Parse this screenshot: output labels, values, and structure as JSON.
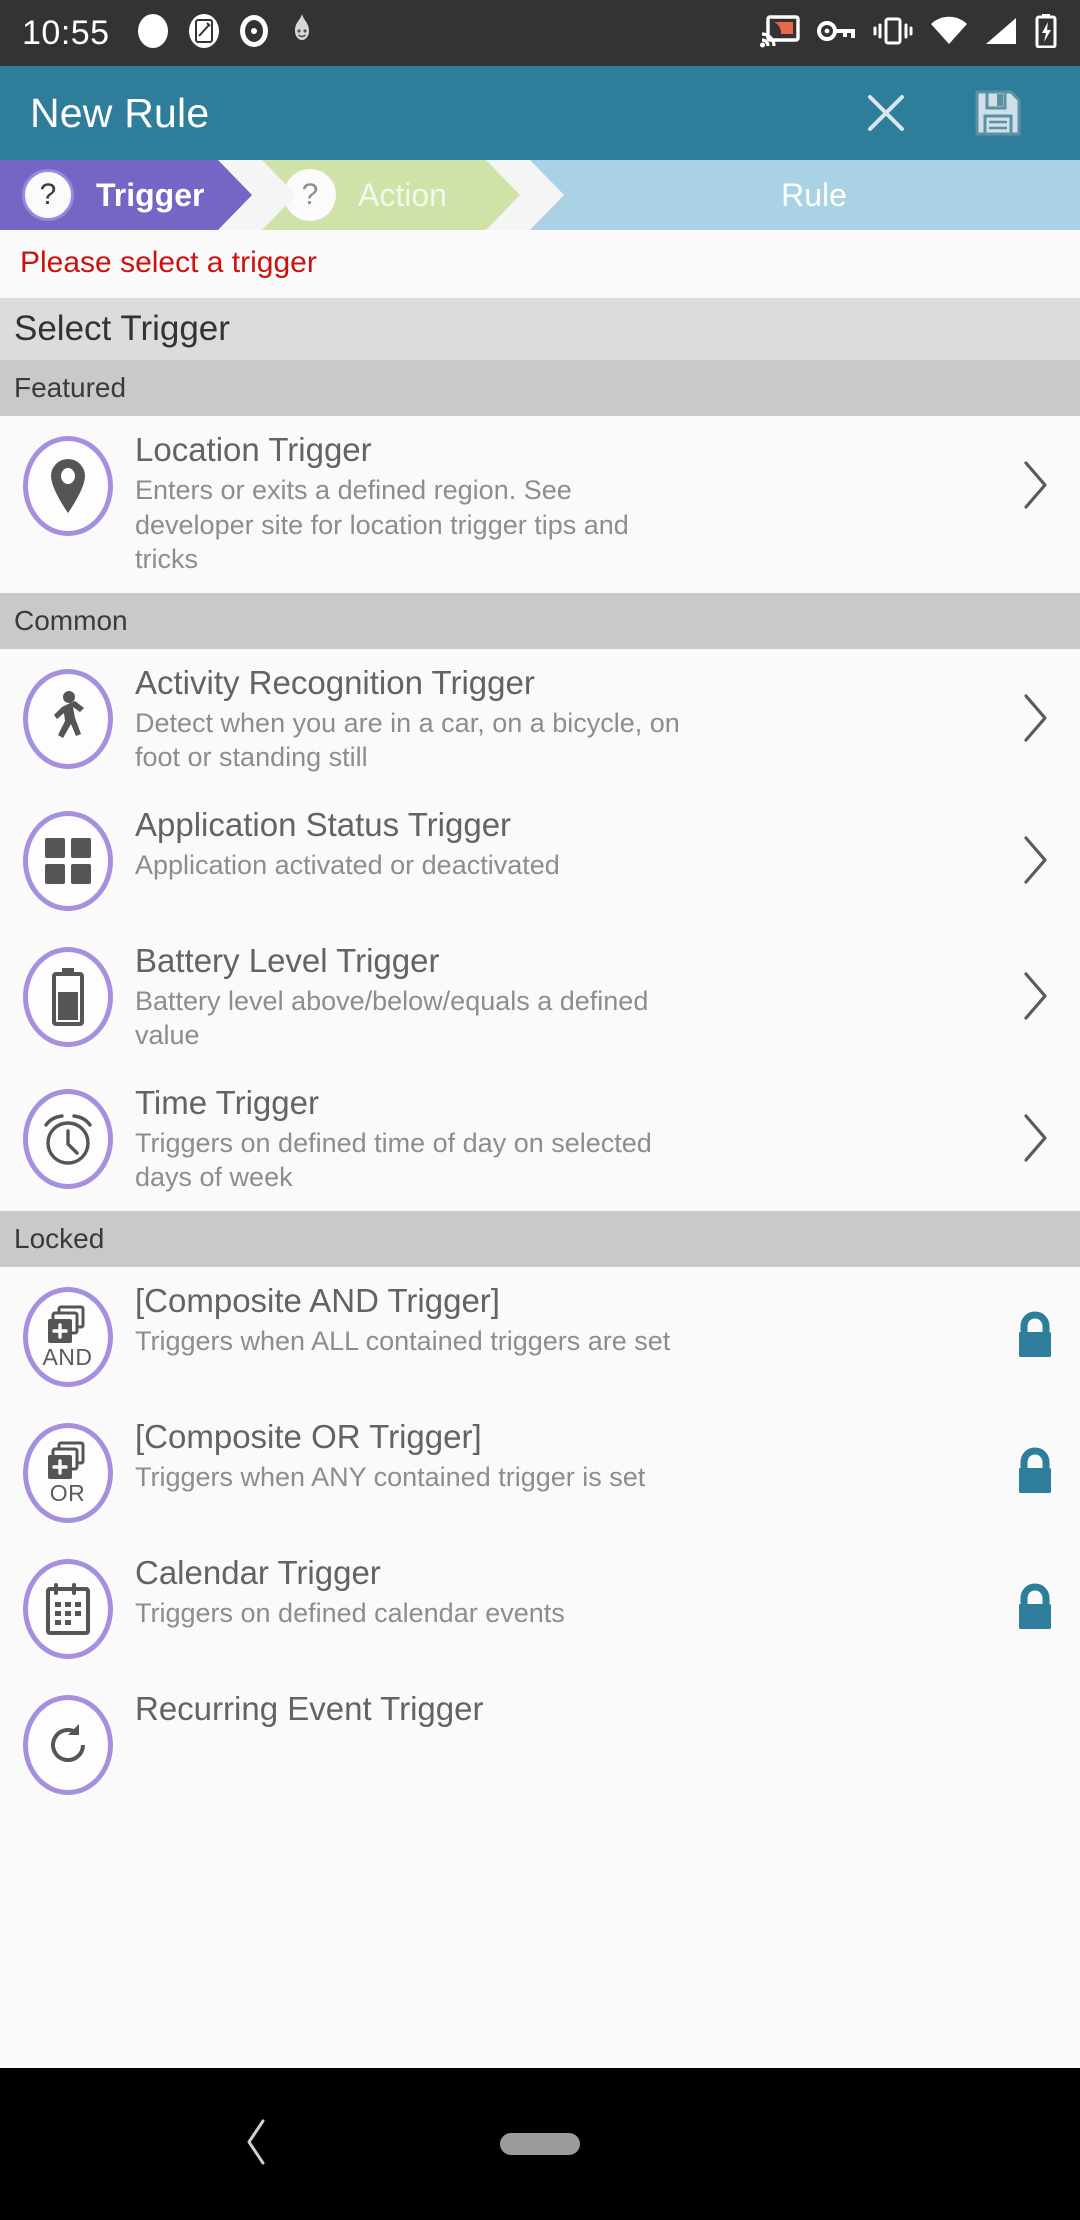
{
  "status_bar": {
    "clock": "10:55",
    "left_icons": [
      "circle-blank-icon",
      "screenshot-edit-icon",
      "record-dot-icon",
      "flame-face-icon"
    ],
    "right_icons": [
      "cast-icon",
      "vpn-key-icon",
      "vibrate-icon",
      "wifi-icon",
      "cell-signal-icon",
      "battery-charging-icon"
    ],
    "background": "#333333",
    "cast_accent": "#e8694a"
  },
  "app_bar": {
    "title": "New Rule",
    "background": "#2e7d9a",
    "close_icon": "close-icon",
    "save_icon": "save-floppy-icon"
  },
  "stepper": {
    "steps": [
      {
        "badge": "?",
        "label": "Trigger",
        "color": "#7565c4",
        "state": "active"
      },
      {
        "badge": "?",
        "label": "Action",
        "color": "#cfe3a8",
        "state": "upcoming"
      },
      {
        "badge": "",
        "label": "Rule",
        "color": "#a9d3e5",
        "state": "upcoming"
      }
    ]
  },
  "error": {
    "message": "Please select a trigger",
    "color": "#cc1111"
  },
  "page": {
    "title": "Select Trigger"
  },
  "groups": [
    {
      "name": "Featured",
      "items": [
        {
          "title": "Location Trigger",
          "desc": "Enters or exits a defined region. See developer site for location trigger tips and tricks",
          "icon": "map-pin-icon",
          "end": "chevron-right-icon"
        }
      ]
    },
    {
      "name": "Common",
      "items": [
        {
          "title": "Activity Recognition Trigger",
          "desc": "Detect when you are in a car, on a bicycle, on foot or standing still",
          "icon": "walking-person-icon",
          "end": "chevron-right-icon"
        },
        {
          "title": "Application Status Trigger",
          "desc": "Application activated or deactivated",
          "icon": "apps-grid-icon",
          "end": "chevron-right-icon"
        },
        {
          "title": "Battery Level Trigger",
          "desc": "Battery level above/below/equals a defined value",
          "icon": "battery-icon",
          "end": "chevron-right-icon"
        },
        {
          "title": "Time Trigger",
          "desc": "Triggers on defined time of day on selected days of week",
          "icon": "alarm-clock-icon",
          "end": "chevron-right-icon"
        }
      ]
    },
    {
      "name": "Locked",
      "items": [
        {
          "title": "[Composite AND Trigger]",
          "desc": "Triggers when ALL contained triggers are set",
          "icon": "composite-and-icon",
          "icon_caption": "AND",
          "end": "lock-icon"
        },
        {
          "title": "[Composite OR Trigger]",
          "desc": "Triggers when ANY contained trigger is set",
          "icon": "composite-or-icon",
          "icon_caption": "OR",
          "end": "lock-icon"
        },
        {
          "title": "Calendar Trigger",
          "desc": "Triggers on defined calendar events",
          "icon": "calendar-icon",
          "end": "lock-icon"
        },
        {
          "title": "Recurring Event Trigger",
          "desc": "",
          "icon": "recurring-event-icon",
          "end": ""
        }
      ]
    }
  ],
  "colors": {
    "accent_purple": "#a78fe0",
    "lock_teal": "#2e7d9a",
    "icon_gray": "#555555"
  },
  "nav_bar": {
    "back_icon": "back-chevron-icon",
    "home_pill": "home-pill-icon"
  }
}
